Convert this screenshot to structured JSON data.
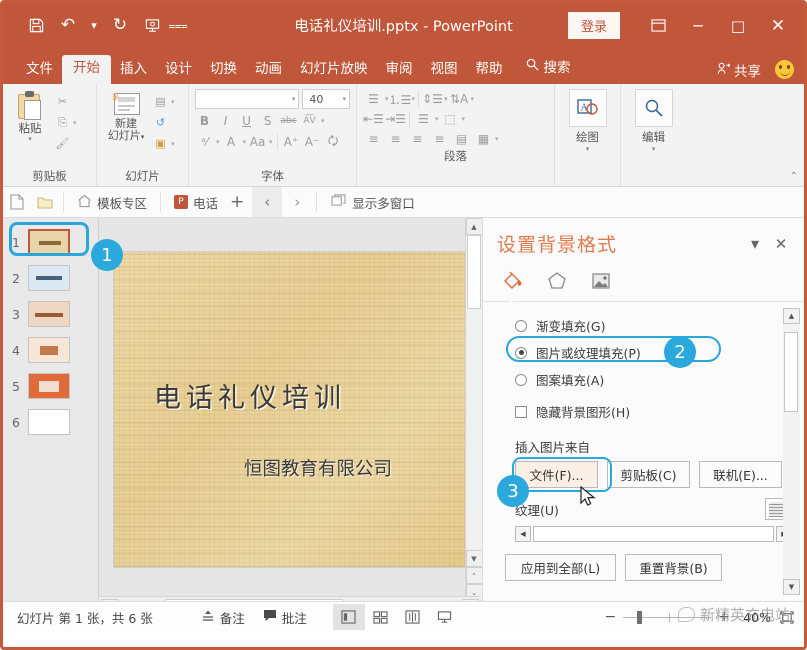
{
  "titlebar": {
    "quick_access": [
      {
        "name": "save-icon",
        "glyph": "ὋE"
      },
      {
        "name": "undo-icon",
        "glyph": "↶"
      },
      {
        "name": "redo-icon",
        "glyph": "↻"
      },
      {
        "name": "start-slideshow-icon",
        "glyph": "⧉"
      },
      {
        "name": "customize-qat-icon",
        "glyph": "▾"
      }
    ],
    "document_title": "电话礼仪培训.pptx  -  PowerPoint",
    "signin_label": "登录",
    "ribbon_display_options": "▣",
    "minimize": "─",
    "maximize": "□",
    "close": "✕"
  },
  "ribbon_tabs": [
    {
      "label": "文件",
      "active": false
    },
    {
      "label": "开始",
      "active": true
    },
    {
      "label": "插入",
      "active": false
    },
    {
      "label": "设计",
      "active": false
    },
    {
      "label": "切换",
      "active": false
    },
    {
      "label": "动画",
      "active": false
    },
    {
      "label": "幻灯片放映",
      "active": false
    },
    {
      "label": "审阅",
      "active": false
    },
    {
      "label": "视图",
      "active": false
    },
    {
      "label": "帮助",
      "active": false
    }
  ],
  "ribbon_search": {
    "label": "搜索",
    "icon": "search-icon"
  },
  "share": {
    "label": "共享",
    "icon": "person-share-icon"
  },
  "ribbon": {
    "groups": [
      {
        "name": "clipboard",
        "label": "剪贴板",
        "big_button": "粘贴",
        "small_buttons": [
          "剪切",
          "复制",
          "格式刷"
        ]
      },
      {
        "name": "slides",
        "label": "幻灯片",
        "big_button": "新建\n幻灯片",
        "small_buttons": [
          "版式",
          "重设",
          "节"
        ]
      },
      {
        "name": "font",
        "label": "字体",
        "font_name": "",
        "font_size": "40",
        "buttons": [
          "B",
          "I",
          "U",
          "S",
          "abc",
          "AV",
          "字符底纹",
          "A",
          "Aa",
          "A↑",
          "A↓",
          "清除格式"
        ]
      },
      {
        "name": "paragraph",
        "label": "段落",
        "buttons": []
      },
      {
        "name": "drawing",
        "label": "绘图",
        "big_button": "绘图"
      },
      {
        "name": "editing",
        "label": "编辑",
        "big_button": "编辑"
      }
    ],
    "collapse_icon": "chevron-up-icon"
  },
  "navbar": {
    "new_doc_icon": "new-document-icon",
    "open_folder_icon": "open-folder-icon",
    "home_label": "模板专区",
    "doc_tab_label": "电话",
    "add_tab": "+",
    "prev": "‹",
    "next": "›",
    "multiwindow_label": "显示多窗口"
  },
  "thumbnails": {
    "slides": [
      {
        "number": "1",
        "selected": true
      },
      {
        "number": "2",
        "selected": false
      },
      {
        "number": "3",
        "selected": false
      },
      {
        "number": "4",
        "selected": false
      },
      {
        "number": "5",
        "selected": false
      },
      {
        "number": "6",
        "selected": false
      }
    ]
  },
  "slide": {
    "title": "电话礼仪培训",
    "subtitle": "恒图教育有限公司"
  },
  "panel": {
    "title": "设置背景格式",
    "dropdown_icon": "chevron-down-icon",
    "close_icon": "close-icon",
    "tabs": [
      {
        "name": "fill-tab",
        "icon": "paint-bucket-icon",
        "active": true
      },
      {
        "name": "effects-tab",
        "icon": "pentagon-icon",
        "active": false
      },
      {
        "name": "picture-tab",
        "icon": "picture-icon",
        "active": false
      }
    ],
    "fill_options": [
      {
        "label": "渐变填充(G)",
        "key": "G",
        "selected": false,
        "type": "radio"
      },
      {
        "label": "图片或纹理填充(P)",
        "key": "P",
        "selected": true,
        "type": "radio",
        "highlighted": true
      },
      {
        "label": "图案填充(A)",
        "key": "A",
        "selected": false,
        "type": "radio"
      },
      {
        "label": "隐藏背景图形(H)",
        "key": "H",
        "selected": false,
        "type": "checkbox"
      }
    ],
    "insert_from_label": "插入图片来自",
    "insert_buttons": [
      {
        "label": "文件(F)...",
        "highlighted": true
      },
      {
        "label": "剪贴板(C)",
        "highlighted": false
      },
      {
        "label": "联机(E)...",
        "highlighted": false
      }
    ],
    "texture_label": "纹理(U)",
    "bottom_buttons": [
      {
        "label": "应用到全部(L)"
      },
      {
        "label": "重置背景(B)"
      }
    ]
  },
  "callouts": [
    {
      "number": "1",
      "target": "slide-thumbnail-1"
    },
    {
      "number": "2",
      "target": "picture-or-texture-fill-option"
    },
    {
      "number": "3",
      "target": "insert-from-file-button"
    }
  ],
  "statusbar": {
    "slide_count_text": "幻灯片 第 1 张，共 6 张",
    "notes_label": "备注",
    "comments_label": "批注",
    "views": [
      {
        "name": "normal-view",
        "active": true
      },
      {
        "name": "slide-sorter-view",
        "active": false
      },
      {
        "name": "reading-view",
        "active": false
      },
      {
        "name": "slideshow-view",
        "active": false
      }
    ],
    "zoom_out": "−",
    "zoom_in": "+",
    "zoom_level": "40%",
    "fit_icon": "fit-slide-icon"
  },
  "watermark": {
    "text": "新精英充电站"
  },
  "colors": {
    "accent": "#c0563a",
    "callout": "#2ba8dc",
    "panel_title": "#e07b4f",
    "slide_bg": "#e8cf95"
  }
}
